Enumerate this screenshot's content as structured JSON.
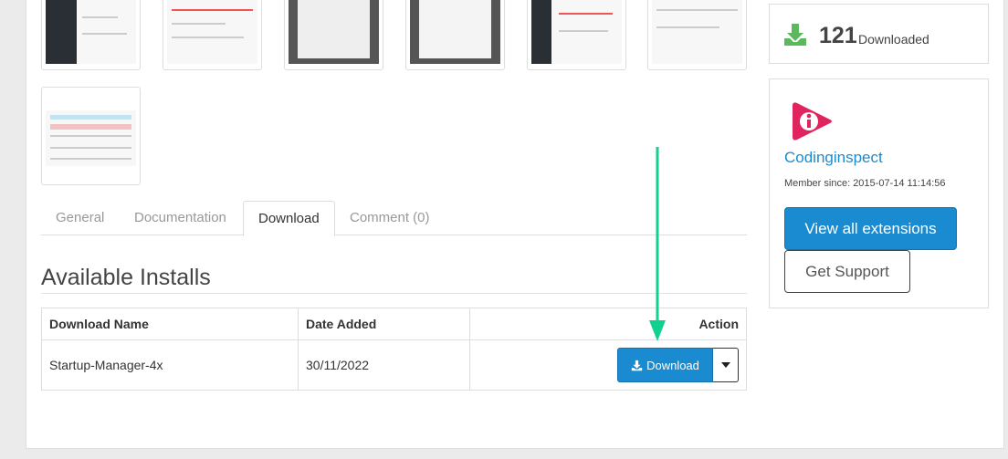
{
  "tabs": [
    {
      "label": "General"
    },
    {
      "label": "Documentation"
    },
    {
      "label": "Download"
    },
    {
      "label": "Comment (0)"
    }
  ],
  "installs": {
    "title": "Available Installs",
    "headers": {
      "name": "Download Name",
      "date": "Date Added",
      "action": "Action"
    },
    "rows": [
      {
        "name": "Startup-Manager-4x",
        "date": "30/11/2022",
        "button_label": "Download"
      }
    ]
  },
  "stats": {
    "downloads": "121",
    "downloads_label": "Downloaded"
  },
  "author": {
    "name": "Codinginspect",
    "member_since": "Member since: 2015-07-14 11:14:56",
    "view_all_label": "View all extensions",
    "support_label": "Get Support"
  },
  "colors": {
    "accent": "#1a8bd0",
    "download_icon": "#5cb85c",
    "annotation_arrow": "#12d18e",
    "logo": "#e0245e"
  }
}
